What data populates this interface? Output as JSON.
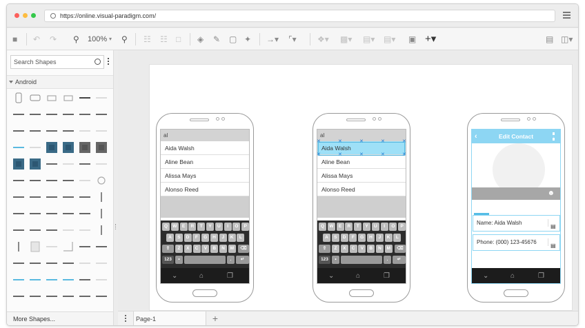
{
  "browser": {
    "url": "https://online.visual-paradigm.com/"
  },
  "toolbar": {
    "zoom": "100%"
  },
  "sidebar": {
    "search_placeholder": "Search Shapes",
    "category": "Android",
    "more_shapes": "More Shapes..."
  },
  "pages": {
    "tab_label": "Page-1"
  },
  "phones": [
    {
      "search_text": "al",
      "contacts": [
        "Aida Walsh",
        "Aline Bean",
        "Alissa Mays",
        "Alonso Reed"
      ]
    },
    {
      "search_text": "al",
      "contacts": [
        "Aida Walsh",
        "Aline Bean",
        "Alissa Mays",
        "Alonso Reed"
      ]
    },
    {
      "header_title": "Edit Contact",
      "name_field": "Name: Aida Walsh",
      "phone_field": "Phone: (000) 123-45676"
    }
  ],
  "keyboard": {
    "row1": [
      "Q",
      "W",
      "E",
      "R",
      "T",
      "Y",
      "U",
      "I",
      "O",
      "P"
    ],
    "row2": [
      "A",
      "S",
      "D",
      "F",
      "G",
      "H",
      "J",
      "K",
      "L"
    ],
    "row3": [
      "Z",
      "X",
      "C",
      "V",
      "B",
      "N",
      "M"
    ],
    "num_key": "123",
    "dot_key": "."
  },
  "colors": {
    "selection": "#9ee0f7",
    "accent": "#8dd6f3",
    "keyboard": "#2c2c2c"
  }
}
